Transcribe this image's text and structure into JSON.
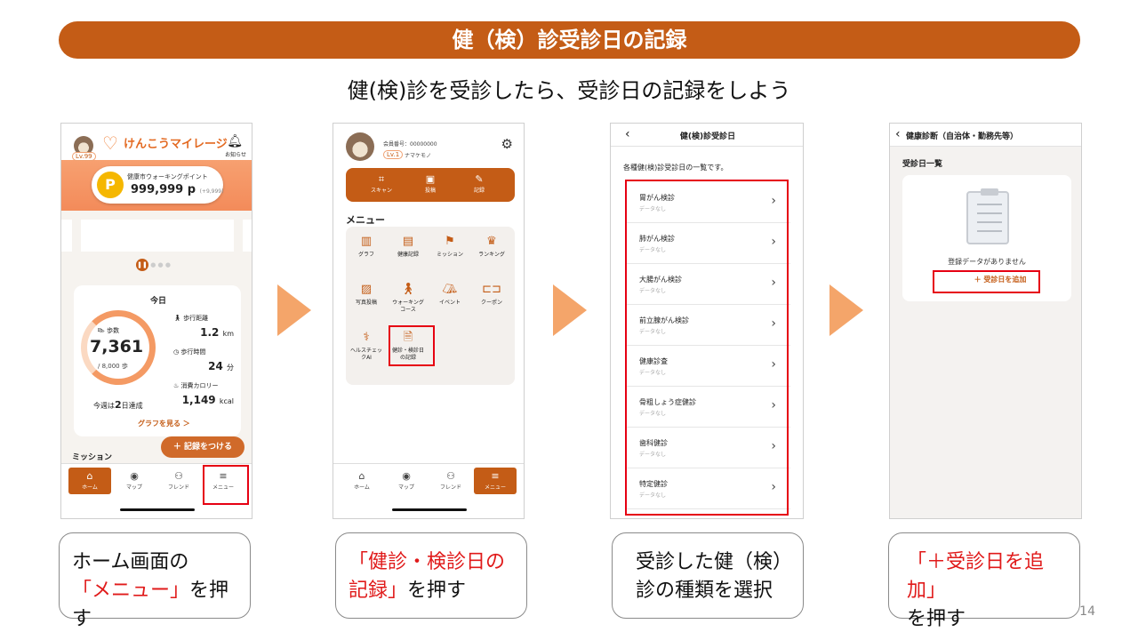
{
  "title": "健（検）診受診日の記録",
  "subtitle": "健(検)診を受診したら、受診日の記録をしよう",
  "phone1": {
    "level": "Lv.99",
    "brand": "けんこうマイレージ",
    "notice_label": "お知らせ",
    "points_label": "健康市ウォーキングポイント",
    "points_value": "999,999 p",
    "points_delta": "(+9,999)",
    "today_label": "今日",
    "steps_label": "歩数",
    "steps_value": "7,361",
    "steps_goal": "/ 8,000 歩",
    "distance_label": "歩行距離",
    "distance_value": "1.2",
    "distance_unit": "km",
    "time_label": "歩行時間",
    "time_value": "24",
    "time_unit": "分",
    "calorie_label": "消費カロリー",
    "calorie_value": "1,149",
    "calorie_unit": "kcal",
    "weekly_pre": "今週は",
    "weekly_days": "2",
    "weekly_post": "日達成",
    "graph_link": "グラフを見る ＞",
    "record_button": "＋ 記録をつける",
    "mission_label": "ミッション",
    "tabs": [
      "ホーム",
      "マップ",
      "フレンド",
      "メニュー"
    ]
  },
  "phone2": {
    "member_no": "会員番号：00000000",
    "level": "Lv.1",
    "nickname": "ナマケモノ",
    "actions": [
      "スキャン",
      "投稿",
      "記録"
    ],
    "menu_label": "メニュー",
    "menu_items": [
      "グラフ",
      "健康記録",
      "ミッション",
      "ランキング",
      "写真投稿",
      "ウォーキング\nコース",
      "イベント",
      "クーポン",
      "ヘルスチェッ\nクAI",
      "健診・検診日\nの記録"
    ],
    "tabs": [
      "ホーム",
      "マップ",
      "フレンド",
      "メニュー"
    ]
  },
  "phone3": {
    "title": "健(検)診受診日",
    "description": "各種健(検)診受診日の一覧です。",
    "no_data": "データなし",
    "exams": [
      "胃がん検診",
      "肺がん検診",
      "大腸がん検診",
      "前立腺がん検診",
      "健康診査",
      "骨粗しょう症健診",
      "歯科健診",
      "特定健診"
    ]
  },
  "phone4": {
    "title": "健康診断（自治体・勤務先等）",
    "section": "受診日一覧",
    "empty": "登録データがありません",
    "add_button": "＋ 受診日を追加"
  },
  "captions": {
    "c1_line1": "ホーム画面の",
    "c1_red": "「メニュー」",
    "c1_post": "を押す",
    "c2_red1": "「健診・検診日の",
    "c2_red2": "記録」",
    "c2_post": "を押す",
    "c3_line1": "受診した健（検）",
    "c3_line2": "診の種類を選択",
    "c4_red": "「＋受診日を追加」",
    "c4_post": "を押す"
  },
  "page_number": "14",
  "colors": {
    "brand": "#c45c16",
    "arrow": "#f4a56a",
    "highlight": "#e60012"
  }
}
